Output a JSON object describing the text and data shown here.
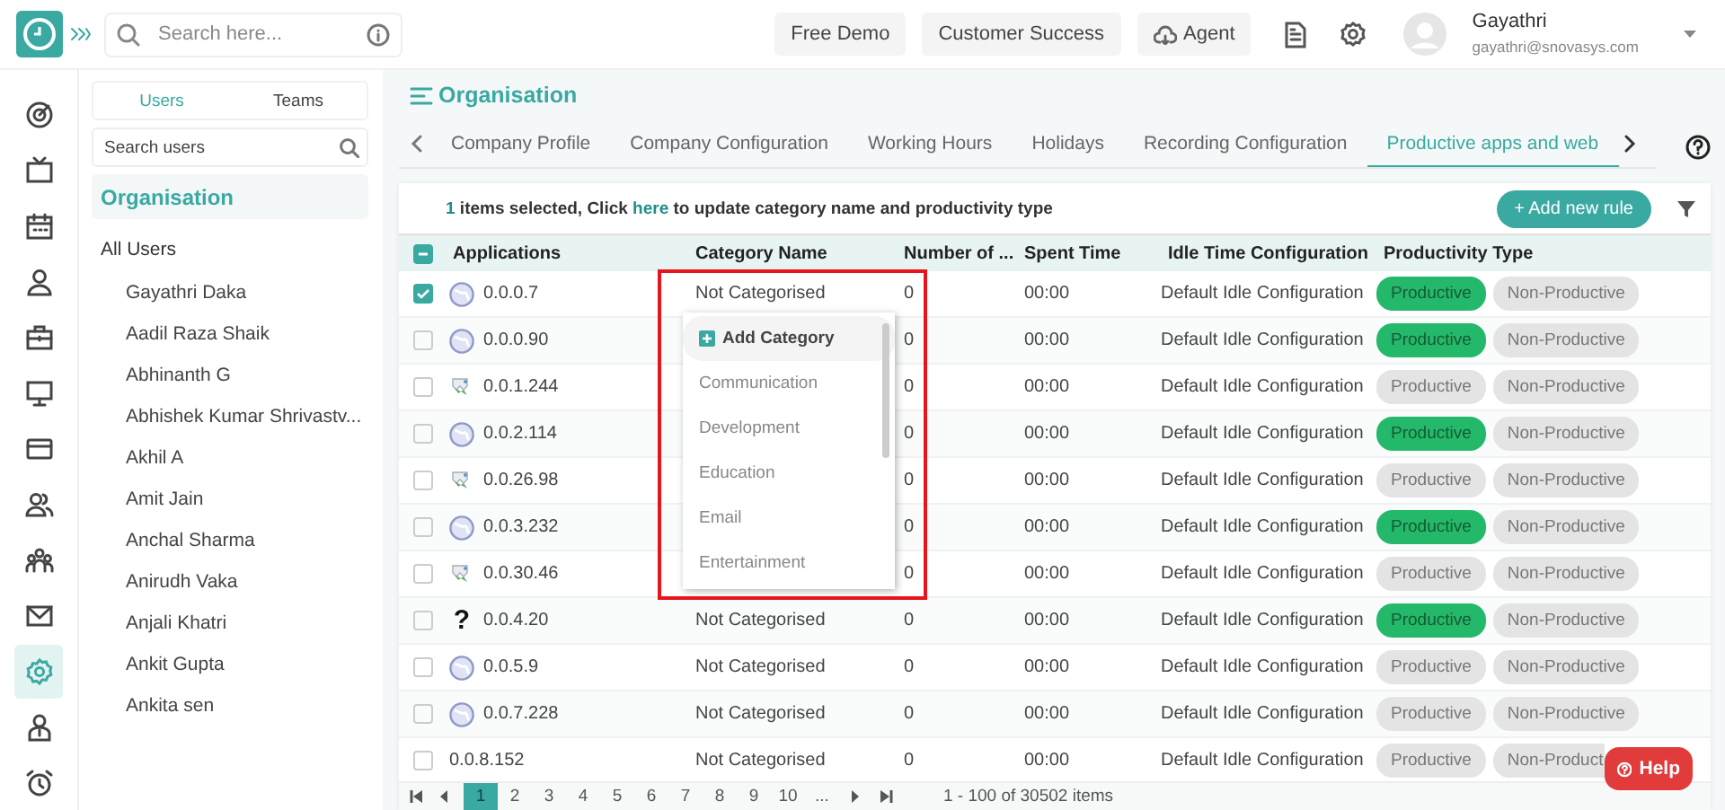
{
  "topbar": {
    "search": {
      "placeholder": "Search here..."
    },
    "buttons": [
      {
        "label": "Free Demo",
        "kind": "plain"
      },
      {
        "label": "Customer Success",
        "kind": "plain"
      },
      {
        "label": "Agent",
        "kind": "cloud"
      }
    ],
    "user": {
      "name": "Gayathri",
      "email": "gayathri@snovasys.com"
    }
  },
  "rail": [
    {
      "selected": false
    },
    {
      "selected": false
    },
    {
      "selected": false
    },
    {
      "selected": false
    },
    {
      "selected": false
    },
    {
      "selected": false
    },
    {
      "selected": false
    },
    {
      "selected": false
    },
    {
      "selected": false
    },
    {
      "selected": false
    },
    {
      "selected": true
    },
    {
      "selected": false
    },
    {
      "selected": false
    }
  ],
  "users_panel": {
    "tabs": [
      {
        "label": "Users",
        "selected": true
      },
      {
        "label": "Teams",
        "selected": false
      }
    ],
    "search": {
      "placeholder": "Search users"
    },
    "groups": [
      {
        "label": "Organisation",
        "selected": true
      },
      {
        "label": "All Users",
        "selected": false,
        "children": [
          {
            "label": "Gayathri Daka"
          },
          {
            "label": "Aadil Raza Shaik"
          },
          {
            "label": "Abhinanth G"
          },
          {
            "label": "Abhishek Kumar Shrivastv..."
          },
          {
            "label": "Akhil A"
          },
          {
            "label": "Amit Jain"
          },
          {
            "label": "Anchal Sharma"
          },
          {
            "label": "Anirudh Vaka"
          },
          {
            "label": "Anjali Khatri"
          },
          {
            "label": "Ankit Gupta"
          },
          {
            "label": "Ankita sen"
          }
        ]
      }
    ]
  },
  "page": {
    "title": "Organisation",
    "tabs": [
      {
        "label": "Company Profile",
        "selected": false
      },
      {
        "label": "Company Configuration",
        "selected": false
      },
      {
        "label": "Working Hours",
        "selected": false
      },
      {
        "label": "Holidays",
        "selected": false
      },
      {
        "label": "Recording Configuration",
        "selected": false
      },
      {
        "label": "Productive apps and web",
        "selected": true
      }
    ]
  },
  "selection_bar": {
    "count": "1",
    "before": " items selected, Click ",
    "link": "here",
    "after": " to update category name and productivity type"
  },
  "add_button": {
    "label": "+ Add new rule"
  },
  "table": {
    "header_checkbox": {
      "checked": true,
      "partial": true
    },
    "columns": [
      "Applications",
      "Category Name",
      "Number of ...",
      "Spent Time",
      "Idle Time Configuration",
      "Productivity Type"
    ],
    "rows": [
      {
        "checked": true,
        "kind": "globe",
        "app": "0.0.0.7",
        "category": "Not Categorised",
        "count": "0",
        "spent": "00:00",
        "idle": "Default Idle Configuration",
        "types": [
          {
            "label": "Productive",
            "selected": true
          },
          {
            "label": "Non-Productive",
            "selected": false
          }
        ]
      },
      {
        "checked": false,
        "kind": "globe",
        "app": "0.0.0.90",
        "count": "0",
        "spent": "00:00",
        "idle": "Default Idle Configuration",
        "types": [
          {
            "label": "Productive",
            "selected": true
          },
          {
            "label": "Non-Productive",
            "selected": false
          }
        ]
      },
      {
        "checked": false,
        "kind": "broken",
        "app": "0.0.1.244",
        "count": "0",
        "spent": "00:00",
        "idle": "Default Idle Configuration",
        "types": [
          {
            "label": "Productive",
            "selected": false
          },
          {
            "label": "Non-Productive",
            "selected": false
          }
        ]
      },
      {
        "checked": false,
        "kind": "globe",
        "app": "0.0.2.114",
        "count": "0",
        "spent": "00:00",
        "idle": "Default Idle Configuration",
        "types": [
          {
            "label": "Productive",
            "selected": true
          },
          {
            "label": "Non-Productive",
            "selected": false
          }
        ]
      },
      {
        "checked": false,
        "kind": "broken",
        "app": "0.0.26.98",
        "count": "0",
        "spent": "00:00",
        "idle": "Default Idle Configuration",
        "types": [
          {
            "label": "Productive",
            "selected": false
          },
          {
            "label": "Non-Productive",
            "selected": false
          }
        ]
      },
      {
        "checked": false,
        "kind": "globe",
        "app": "0.0.3.232",
        "count": "0",
        "spent": "00:00",
        "idle": "Default Idle Configuration",
        "types": [
          {
            "label": "Productive",
            "selected": true
          },
          {
            "label": "Non-Productive",
            "selected": false
          }
        ]
      },
      {
        "checked": false,
        "kind": "broken",
        "app": "0.0.30.46",
        "count": "0",
        "spent": "00:00",
        "idle": "Default Idle Configuration",
        "types": [
          {
            "label": "Productive",
            "selected": false
          },
          {
            "label": "Non-Productive",
            "selected": false
          }
        ]
      },
      {
        "checked": false,
        "kind": "glyph",
        "icon_text": "?",
        "app": "0.0.4.20",
        "category": "Not Categorised",
        "count": "0",
        "spent": "00:00",
        "idle": "Default Idle Configuration",
        "types": [
          {
            "label": "Productive",
            "selected": true
          },
          {
            "label": "Non-Productive",
            "selected": false
          }
        ]
      },
      {
        "checked": false,
        "kind": "globe",
        "app": "0.0.5.9",
        "category": "Not Categorised",
        "count": "0",
        "spent": "00:00",
        "idle": "Default Idle Configuration",
        "types": [
          {
            "label": "Productive",
            "selected": false
          },
          {
            "label": "Non-Productive",
            "selected": false
          }
        ]
      },
      {
        "checked": false,
        "kind": "globe",
        "app": "0.0.7.228",
        "category": "Not Categorised",
        "count": "0",
        "spent": "00:00",
        "idle": "Default Idle Configuration",
        "types": [
          {
            "label": "Productive",
            "selected": false
          },
          {
            "label": "Non-Productive",
            "selected": false
          }
        ]
      },
      {
        "checked": false,
        "kind": "none",
        "app": "0.0.8.152",
        "category": "Not Categorised",
        "count": "0",
        "spent": "00:00",
        "idle": "Default Idle Configuration",
        "types": [
          {
            "label": "Productive",
            "selected": false
          },
          {
            "label": "Non-Product",
            "selected": false
          }
        ]
      }
    ]
  },
  "dropdown": {
    "items": [
      {
        "label": "Add Category",
        "kind": "add"
      },
      {
        "label": "Communication",
        "kind": "option"
      },
      {
        "label": "Development",
        "kind": "option"
      },
      {
        "label": "Education",
        "kind": "option"
      },
      {
        "label": "Email",
        "kind": "option"
      },
      {
        "label": "Entertainment",
        "kind": "option"
      }
    ]
  },
  "highlight_box": true,
  "pagination": {
    "pages": [
      {
        "label": "1",
        "selected": true
      },
      {
        "label": "2",
        "selected": false
      },
      {
        "label": "3",
        "selected": false
      },
      {
        "label": "4",
        "selected": false
      },
      {
        "label": "5",
        "selected": false
      },
      {
        "label": "6",
        "selected": false
      },
      {
        "label": "7",
        "selected": false
      },
      {
        "label": "8",
        "selected": false
      },
      {
        "label": "9",
        "selected": false
      },
      {
        "label": "10",
        "selected": false
      },
      {
        "label": "...",
        "selected": false
      }
    ],
    "info": "1 - 100 of 30502 items"
  },
  "help_button": {
    "label": "Help"
  }
}
